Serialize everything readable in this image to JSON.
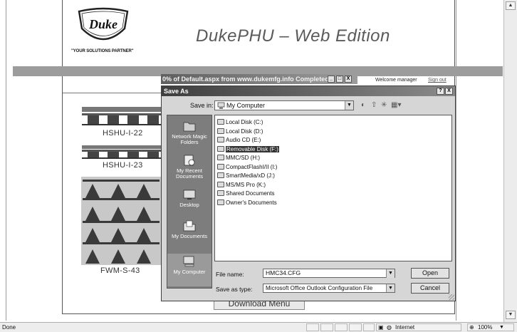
{
  "brand": {
    "logo_text": "Duke",
    "tagline": "\"YOUR SOLUTIONS PARTNER\"",
    "app_title": "DukePHU – Web Edition"
  },
  "header": {
    "welcome": "Welcome manager",
    "signout": "Sign out"
  },
  "products": [
    {
      "label": "HSHU-I-22"
    },
    {
      "label": "HSHU-I-23"
    },
    {
      "label": "FWM-S-43"
    }
  ],
  "download_button": "Download Menu",
  "progress_window": {
    "title": "0% of Default.aspx from www.dukemfg.info Completed",
    "buttons": [
      "_",
      "□",
      "X"
    ]
  },
  "save_dialog": {
    "title": "Save As",
    "title_buttons": [
      "?",
      "X"
    ],
    "save_in_label": "Save in:",
    "save_in_value": "My Computer",
    "places": [
      {
        "label": "Network Magic Folders",
        "icon": "network-folder-icon"
      },
      {
        "label": "My Recent Documents",
        "icon": "recent-documents-icon"
      },
      {
        "label": "Desktop",
        "icon": "desktop-icon"
      },
      {
        "label": "My Documents",
        "icon": "my-documents-icon"
      },
      {
        "label": "My Computer",
        "icon": "my-computer-icon"
      }
    ],
    "drives": [
      {
        "label": "Local Disk (C:)",
        "icon": "hard-disk-icon"
      },
      {
        "label": "Local Disk (D:)",
        "icon": "hard-disk-icon"
      },
      {
        "label": "Audio CD (E:)",
        "icon": "cd-drive-icon"
      },
      {
        "label": "Removable Disk (F:)",
        "icon": "removable-disk-icon"
      },
      {
        "label": "MMC/SD (H:)",
        "icon": "memory-card-icon"
      },
      {
        "label": "CompactFlashI/II (I:)",
        "icon": "memory-card-icon"
      },
      {
        "label": "SmartMedia/xD (J:)",
        "icon": "memory-card-icon"
      },
      {
        "label": "MS/MS Pro (K:)",
        "icon": "memory-card-icon"
      },
      {
        "label": "Shared Documents",
        "icon": "folder-icon"
      },
      {
        "label": "Owner's Documents",
        "icon": "folder-icon"
      }
    ],
    "selected_drive_index": 3,
    "file_name_label": "File name:",
    "file_name_value": "HMC34.CFG",
    "save_as_type_label": "Save as type:",
    "save_as_type_value": "Microsoft Office Outlook Configuration File",
    "open_button": "Open",
    "cancel_button": "Cancel"
  },
  "statusbar": {
    "left_text": "Done",
    "zone": "Internet",
    "zoom": "100%"
  }
}
